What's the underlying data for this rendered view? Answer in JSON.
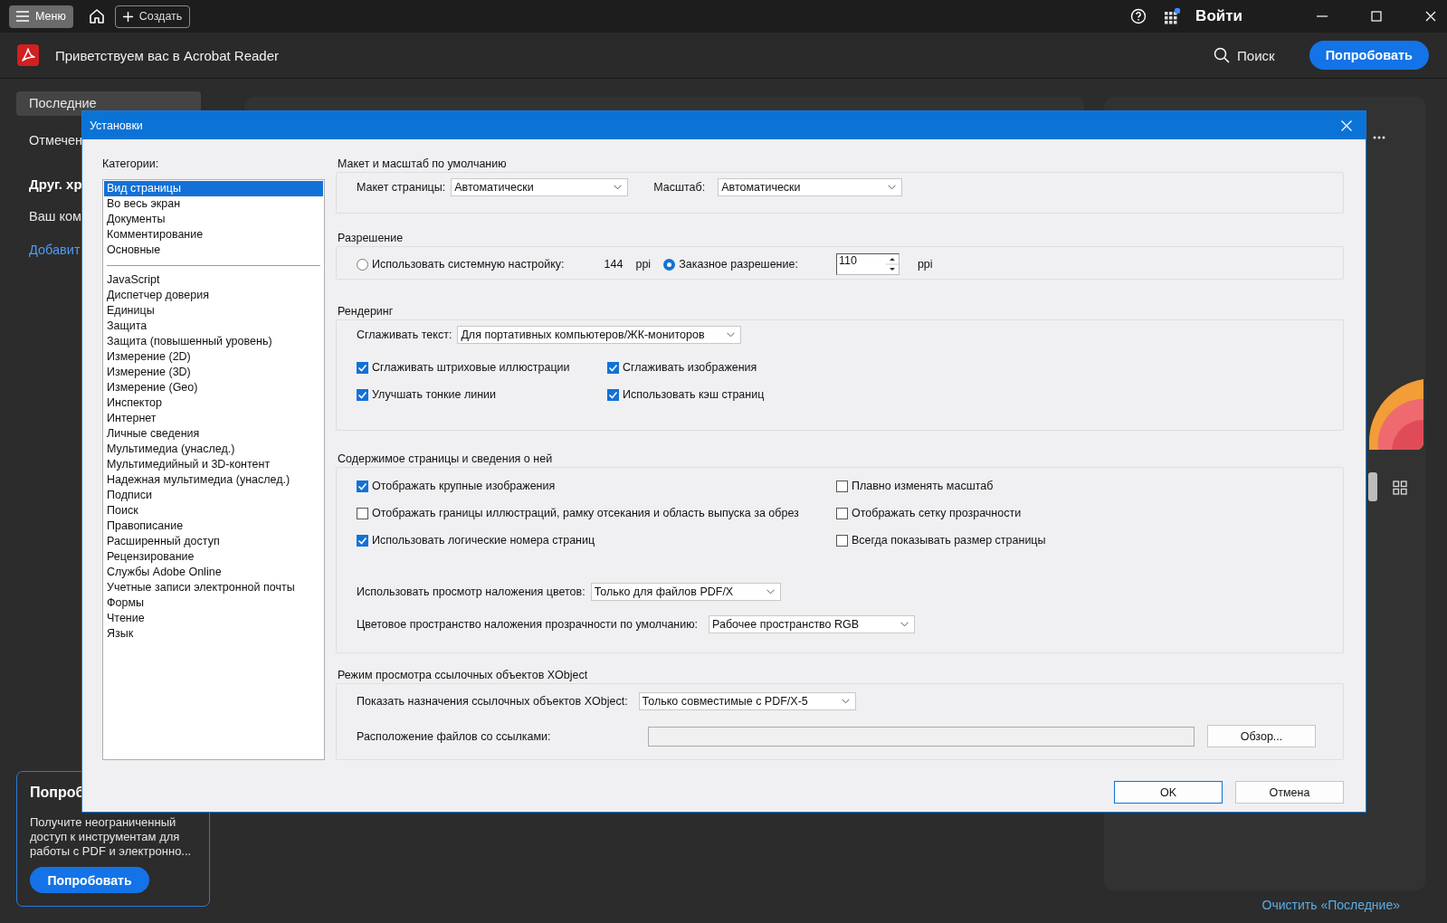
{
  "titlebar": {
    "menu_button": "Меню",
    "create_button": "Создать",
    "sign_in": "Войти"
  },
  "header": {
    "title": "Приветствуем вас в Acrobat Reader",
    "search": "Поиск",
    "try_button": "Попробовать"
  },
  "sidebar": {
    "items": [
      {
        "label": "Последние",
        "selected": true
      },
      {
        "label": "Отмечен",
        "selected": false
      }
    ],
    "section_title": "Друг. хр",
    "storage_item": "Ваш ком",
    "add_link": "Добавит"
  },
  "promo": {
    "title": "Попроб",
    "text": "Получите неограниченный доступ к инструментам для работы с PDF и электронно...",
    "button": "Попробовать"
  },
  "clear_recent_link": "Очистить «Последние»",
  "dialog": {
    "title": "Установки",
    "categories_label": "Категории:",
    "category_groups": [
      {
        "items": [
          {
            "label": "Вид страницы",
            "selected": true
          },
          {
            "label": "Во весь экран",
            "selected": false
          },
          {
            "label": "Документы",
            "selected": false
          },
          {
            "label": "Комментирование",
            "selected": false
          },
          {
            "label": "Основные",
            "selected": false
          }
        ]
      },
      {
        "items": [
          {
            "label": "JavaScript",
            "selected": false
          },
          {
            "label": "Диспетчер доверия",
            "selected": false
          },
          {
            "label": "Единицы",
            "selected": false
          },
          {
            "label": "Защита",
            "selected": false
          },
          {
            "label": "Защита (повышенный уровень)",
            "selected": false
          },
          {
            "label": "Измерение (2D)",
            "selected": false
          },
          {
            "label": "Измерение (3D)",
            "selected": false
          },
          {
            "label": "Измерение (Geo)",
            "selected": false
          },
          {
            "label": "Инспектор",
            "selected": false
          },
          {
            "label": "Интернет",
            "selected": false
          },
          {
            "label": "Личные сведения",
            "selected": false
          },
          {
            "label": "Мультимедиа (унаслед.)",
            "selected": false
          },
          {
            "label": "Мультимедийный и 3D-контент",
            "selected": false
          },
          {
            "label": "Надежная мультимедиа (унаслед.)",
            "selected": false
          },
          {
            "label": "Подписи",
            "selected": false
          },
          {
            "label": "Поиск",
            "selected": false
          },
          {
            "label": "Правописание",
            "selected": false
          },
          {
            "label": "Расширенный доступ",
            "selected": false
          },
          {
            "label": "Рецензирование",
            "selected": false
          },
          {
            "label": "Службы Adobe Online",
            "selected": false
          },
          {
            "label": "Учетные записи электронной почты",
            "selected": false
          },
          {
            "label": "Формы",
            "selected": false
          },
          {
            "label": "Чтение",
            "selected": false
          },
          {
            "label": "Язык",
            "selected": false
          }
        ]
      }
    ],
    "layout_section": {
      "title": "Макет и масштаб по умолчанию",
      "page_layout": {
        "label": "Макет страницы:",
        "value": "Автоматически"
      },
      "zoom": {
        "label": "Масштаб:",
        "value": "Автоматически"
      }
    },
    "resolution_section": {
      "title": "Разрешение",
      "options": [
        {
          "label": "Использовать системную настройку:",
          "selected": false,
          "value": "144",
          "unit": "ppi"
        },
        {
          "label": "Заказное разрешение:",
          "selected": true,
          "value": "110",
          "unit": "ppi"
        }
      ]
    },
    "rendering_section": {
      "title": "Рендеринг",
      "smooth_text": {
        "label": "Сглаживать текст:",
        "value": "Для портативных компьютеров/ЖК-мониторов"
      },
      "checkboxes": [
        {
          "label": "Сглаживать штриховые иллюстрации",
          "checked": true
        },
        {
          "label": "Сглаживать изображения",
          "checked": true
        },
        {
          "label": "Улучшать тонкие линии",
          "checked": true
        },
        {
          "label": "Использовать кэш страниц",
          "checked": true
        }
      ]
    },
    "content_section": {
      "title": "Содержимое страницы и сведения о ней",
      "checkboxes": [
        {
          "label": "Отображать крупные изображения",
          "checked": true
        },
        {
          "label": "Плавно изменять масштаб",
          "checked": false
        },
        {
          "label": "Отображать границы иллюстраций, рамку отсекания и область выпуска за обрез",
          "checked": false
        },
        {
          "label": "Отображать сетку прозрачности",
          "checked": false
        },
        {
          "label": "Использовать логические номера страниц",
          "checked": true
        },
        {
          "label": "Всегда показывать размер страницы",
          "checked": false
        }
      ],
      "overprint": {
        "label": "Использовать просмотр наложения цветов:",
        "value": "Только для файлов PDF/X"
      },
      "blend_space": {
        "label": "Цветовое пространство наложения прозрачности по умолчанию:",
        "value": "Рабочее пространство RGB"
      }
    },
    "xobject_section": {
      "title": "Режим просмотра ссылочных объектов XObject",
      "show_targets": {
        "label": "Показать назначения ссылочных объектов XObject:",
        "value": "Только совместимые с PDF/X-5"
      },
      "location": {
        "label": "Расположение файлов со ссылками:"
      },
      "browse_button": "Обзор..."
    },
    "buttons": [
      "OK",
      "Отмена"
    ]
  }
}
